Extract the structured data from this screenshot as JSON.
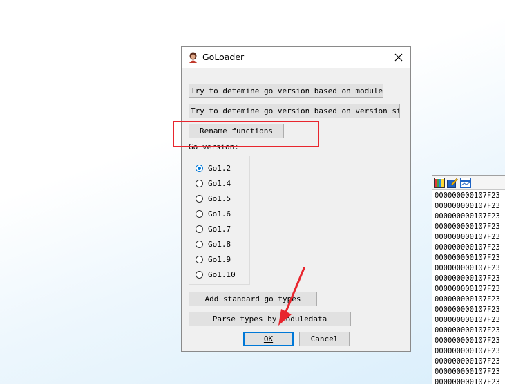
{
  "dialog": {
    "title": "GoLoader",
    "buttons": {
      "try_moduledata": "Try to detemine go version based on moduledata",
      "try_version_string": "Try to detemine go version based on version string",
      "rename_functions": "Rename functions",
      "add_standard_types": "Add standard go types",
      "parse_types": "Parse types by moduledata",
      "ok": "OK",
      "cancel": "Cancel"
    },
    "version_group_label": "Go version:",
    "versions": [
      "Go1.2",
      "Go1.4",
      "Go1.5",
      "Go1.6",
      "Go1.7",
      "Go1.8",
      "Go1.9",
      "Go1.10"
    ],
    "selected_version": "Go1.2"
  },
  "hex_view": {
    "lines": [
      "000000000107F23",
      "000000000107F23",
      "000000000107F23",
      "000000000107F23",
      "000000000107F23",
      "000000000107F23",
      "000000000107F23",
      "000000000107F23",
      "000000000107F23",
      "000000000107F23",
      "000000000107F23",
      "000000000107F23",
      "000000000107F23",
      "000000000107F23",
      "000000000107F23",
      "000000000107F23",
      "000000000107F23",
      "000000000107F23",
      "000000000107F23"
    ],
    "toolbar_icons": [
      "color-palette-icon",
      "edit-icon",
      "graph-icon"
    ]
  },
  "annotations": {
    "highlight_color": "#e8262e"
  }
}
